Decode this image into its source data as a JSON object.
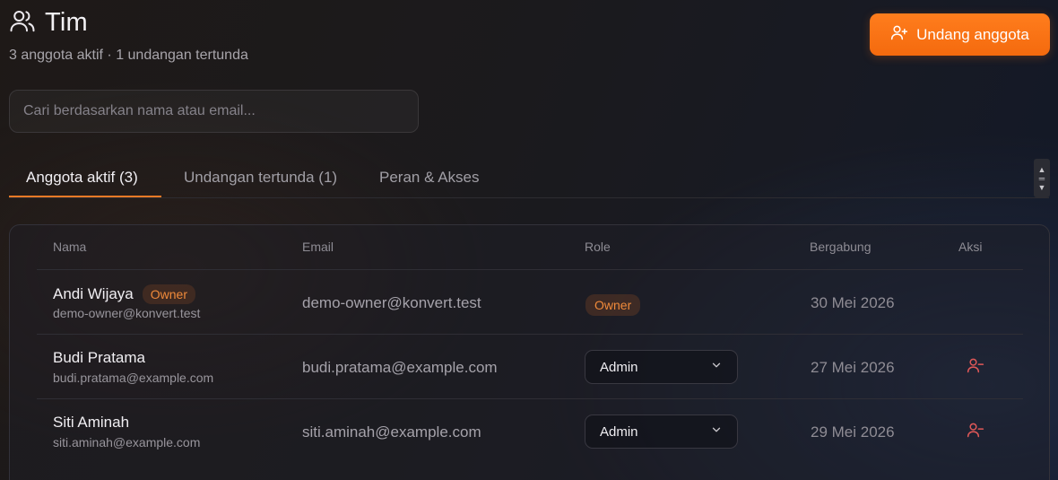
{
  "header": {
    "title": "Tim",
    "subtitle": "3 anggota aktif · 1 undangan tertunda",
    "icon": "users-icon"
  },
  "invite_button": {
    "label": "Undang anggota",
    "icon": "user-plus-icon",
    "color": "#f47316"
  },
  "search": {
    "placeholder": "Cari berdasarkan nama atau email...",
    "value": ""
  },
  "tabs": [
    {
      "label": "Anggota aktif (3)",
      "active": true
    },
    {
      "label": "Undangan tertunda (1)",
      "active": false
    },
    {
      "label": "Peran & Akses",
      "active": false
    }
  ],
  "table": {
    "headers": {
      "name": "Nama",
      "email": "Email",
      "role": "Role",
      "joined": "Bergabung",
      "actions": "Aksi"
    },
    "rows": [
      {
        "name": "Andi Wijaya",
        "badge": "Owner",
        "sub_email": "demo-owner@konvert.test",
        "email": "demo-owner@konvert.test",
        "role": "Owner",
        "joined": "30 Mei 2026"
      },
      {
        "name": "Budi Pratama",
        "sub_email": "budi.pratama@example.com",
        "email": "budi.pratama@example.com",
        "role": "Admin",
        "joined": "27 Mei 2026"
      },
      {
        "name": "Siti Aminah",
        "sub_email": "siti.aminah@example.com",
        "email": "siti.aminah@example.com",
        "role": "Admin",
        "joined": "29 Mei 2026"
      }
    ]
  },
  "colors": {
    "accent": "#f47316",
    "danger": "#e05858"
  }
}
